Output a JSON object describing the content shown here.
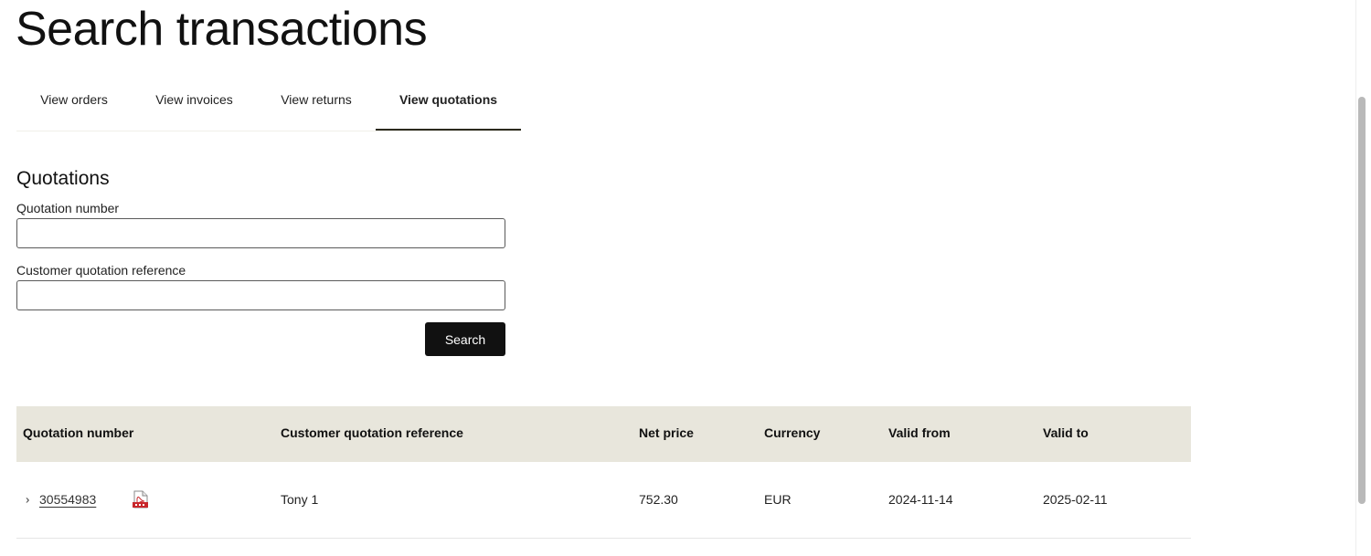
{
  "page": {
    "title": "Search transactions"
  },
  "tabs": [
    {
      "label": "View orders",
      "active": false
    },
    {
      "label": "View invoices",
      "active": false
    },
    {
      "label": "View returns",
      "active": false
    },
    {
      "label": "View quotations",
      "active": true
    }
  ],
  "form": {
    "section_title": "Quotations",
    "quotation_number_label": "Quotation number",
    "quotation_number_value": "",
    "customer_ref_label": "Customer quotation reference",
    "customer_ref_value": "",
    "search_label": "Search"
  },
  "table": {
    "headers": [
      "Quotation number",
      "Customer quotation reference",
      "Net price",
      "Currency",
      "Valid from",
      "Valid to"
    ],
    "rows": [
      {
        "quotation_number": "30554983",
        "customer_ref": "Tony 1",
        "net_price": "752.30",
        "currency": "EUR",
        "valid_from": "2024-11-14",
        "valid_to": "2025-02-11",
        "icon": "pdf-icon"
      }
    ]
  },
  "colors": {
    "accent": "#111111",
    "header_bg": "#e8e6dc",
    "tab_underline": "#2b2a1e",
    "pdf_red": "#c8262b"
  }
}
